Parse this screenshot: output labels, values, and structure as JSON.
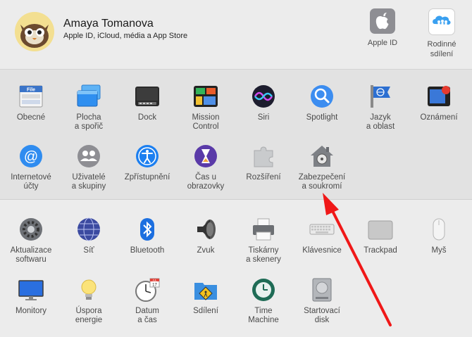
{
  "user": {
    "name": "Amaya Tomanova",
    "subtitle": "Apple ID, iCloud, média a App Store"
  },
  "header_items": [
    {
      "label": "Apple ID",
      "icon": "apple-id-icon"
    },
    {
      "label": "Rodinné\nsdílení",
      "icon": "family-sharing-icon"
    }
  ],
  "row1": [
    {
      "label": "Obecné",
      "icon": "general-icon"
    },
    {
      "label": "Plocha\na spořič",
      "icon": "desktop-screensaver-icon"
    },
    {
      "label": "Dock",
      "icon": "dock-icon"
    },
    {
      "label": "Mission\nControl",
      "icon": "mission-control-icon"
    },
    {
      "label": "Siri",
      "icon": "siri-icon"
    },
    {
      "label": "Spotlight",
      "icon": "spotlight-icon"
    },
    {
      "label": "Jazyk\na oblast",
      "icon": "language-region-icon"
    },
    {
      "label": "Oznámení",
      "icon": "notifications-icon"
    }
  ],
  "row2": [
    {
      "label": "Internetové\núčty",
      "icon": "internet-accounts-icon"
    },
    {
      "label": "Uživatelé\na skupiny",
      "icon": "users-groups-icon"
    },
    {
      "label": "Zpřístupnění",
      "icon": "accessibility-icon"
    },
    {
      "label": "Čas u obrazovky",
      "icon": "screen-time-icon"
    },
    {
      "label": "Rozšíření",
      "icon": "extensions-icon"
    },
    {
      "label": "Zabezpečení\na soukromí",
      "icon": "security-privacy-icon"
    }
  ],
  "row3": [
    {
      "label": "Aktualizace\nsoftwaru",
      "icon": "software-update-icon"
    },
    {
      "label": "Síť",
      "icon": "network-icon"
    },
    {
      "label": "Bluetooth",
      "icon": "bluetooth-icon"
    },
    {
      "label": "Zvuk",
      "icon": "sound-icon"
    },
    {
      "label": "Tiskárny\na skenery",
      "icon": "printers-scanners-icon"
    },
    {
      "label": "Klávesnice",
      "icon": "keyboard-icon"
    },
    {
      "label": "Trackpad",
      "icon": "trackpad-icon"
    },
    {
      "label": "Myš",
      "icon": "mouse-icon"
    }
  ],
  "row4": [
    {
      "label": "Monitory",
      "icon": "displays-icon"
    },
    {
      "label": "Úspora\nenergie",
      "icon": "energy-saver-icon"
    },
    {
      "label": "Datum\na čas",
      "icon": "date-time-icon"
    },
    {
      "label": "Sdílení",
      "icon": "sharing-icon"
    },
    {
      "label": "Time\nMachine",
      "icon": "time-machine-icon"
    },
    {
      "label": "Startovací\ndisk",
      "icon": "startup-disk-icon"
    }
  ],
  "calendar_badge": {
    "month": "JUL",
    "day": "17"
  },
  "colors": {
    "annotation_arrow": "#f01818",
    "accent": "#1e7bf0"
  }
}
